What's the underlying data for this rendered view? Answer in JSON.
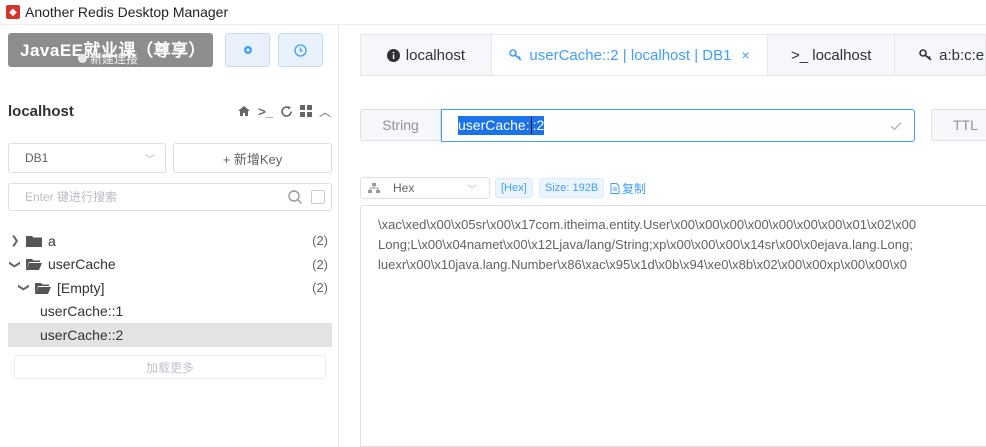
{
  "window": {
    "title": "Another Redis Desktop Manager"
  },
  "overlay": {
    "watermark": "JavaEE就业课（尊享）"
  },
  "toolbar": {
    "new_connection_label": "新建连接"
  },
  "connection": {
    "name": "localhost"
  },
  "db_select": {
    "value": "DB1"
  },
  "add_key": {
    "label": "+ 新增Key"
  },
  "search": {
    "placeholder": "Enter 键进行搜索"
  },
  "tree": {
    "items": [
      {
        "label": "a",
        "count": "(2)",
        "arrow": "›"
      },
      {
        "label": "userCache",
        "count": "(2)",
        "arrow": "⌄"
      },
      {
        "label": "[Empty]",
        "count": "(2)",
        "arrow": "⌄"
      },
      {
        "label": "userCache::1",
        "count": ""
      },
      {
        "label": "userCache::2",
        "count": ""
      }
    ]
  },
  "load_more": {
    "label": "加载更多"
  },
  "tabs": [
    {
      "label": "localhost",
      "icon": "info-icon"
    },
    {
      "label": "userCache::2 | localhost | DB1",
      "icon": "key-icon",
      "close": "×"
    },
    {
      "label": ">_ localhost",
      "icon": "terminal-icon"
    },
    {
      "label": "a:b:c:e",
      "icon": "key-icon"
    }
  ],
  "key_detail": {
    "type": "String",
    "key_before_cursor": "userCache:",
    "key_after_cursor": ":2",
    "ttl_label": "TTL"
  },
  "value_toolbar": {
    "format": "Hex",
    "hex_tag": "[Hex]",
    "size_tag": "Size: 192B",
    "copy_label": "复制"
  },
  "value": {
    "lines": [
      "\\xac\\xed\\x00\\x05sr\\x00\\x17com.itheima.entity.User\\x00\\x00\\x00\\x00\\x00\\x00\\x00\\x01\\x02\\x00",
      "Long;L\\x00\\x04namet\\x00\\x12Ljava/lang/String;xp\\x00\\x00\\x00\\x14sr\\x00\\x0ejava.lang.Long;",
      "luexr\\x00\\x10java.lang.Number\\x86\\xac\\x95\\x1d\\x0b\\x94\\xe0\\x8b\\x02\\x00\\x00xp\\x00\\x00\\x0"
    ]
  },
  "colors": {
    "accent": "#409eff",
    "selection": "#1a73e8",
    "logo": "#d9342b"
  }
}
